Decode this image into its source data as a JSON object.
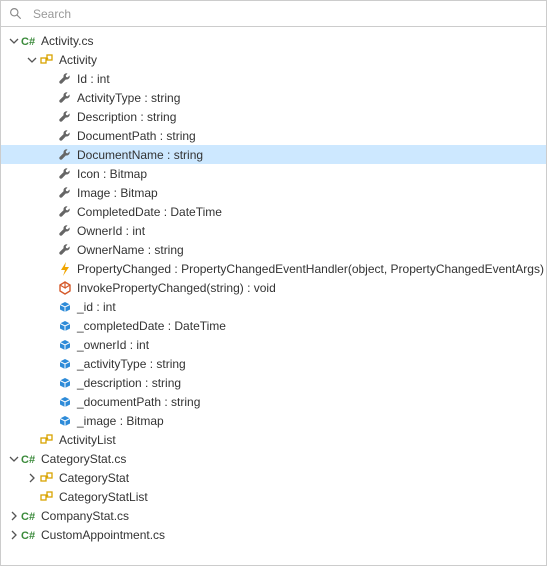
{
  "search": {
    "placeholder": "Search",
    "value": ""
  },
  "tree": [
    {
      "depth": 0,
      "expander": "open",
      "icon": "cs-file",
      "label": "Activity.cs",
      "selected": false
    },
    {
      "depth": 1,
      "expander": "open",
      "icon": "class",
      "label": "Activity",
      "selected": false
    },
    {
      "depth": 2,
      "expander": "none",
      "icon": "wrench",
      "label": "Id : int",
      "selected": false
    },
    {
      "depth": 2,
      "expander": "none",
      "icon": "wrench",
      "label": "ActivityType : string",
      "selected": false
    },
    {
      "depth": 2,
      "expander": "none",
      "icon": "wrench",
      "label": "Description : string",
      "selected": false
    },
    {
      "depth": 2,
      "expander": "none",
      "icon": "wrench",
      "label": "DocumentPath : string",
      "selected": false
    },
    {
      "depth": 2,
      "expander": "none",
      "icon": "wrench",
      "label": "DocumentName : string",
      "selected": true
    },
    {
      "depth": 2,
      "expander": "none",
      "icon": "wrench",
      "label": "Icon : Bitmap",
      "selected": false
    },
    {
      "depth": 2,
      "expander": "none",
      "icon": "wrench",
      "label": "Image : Bitmap",
      "selected": false
    },
    {
      "depth": 2,
      "expander": "none",
      "icon": "wrench",
      "label": "CompletedDate : DateTime",
      "selected": false
    },
    {
      "depth": 2,
      "expander": "none",
      "icon": "wrench",
      "label": "OwnerId : int",
      "selected": false
    },
    {
      "depth": 2,
      "expander": "none",
      "icon": "wrench",
      "label": "OwnerName : string",
      "selected": false
    },
    {
      "depth": 2,
      "expander": "none",
      "icon": "event",
      "label": "PropertyChanged : PropertyChangedEventHandler(object, PropertyChangedEventArgs)",
      "selected": false
    },
    {
      "depth": 2,
      "expander": "none",
      "icon": "method",
      "label": "InvokePropertyChanged(string) : void",
      "selected": false
    },
    {
      "depth": 2,
      "expander": "none",
      "icon": "field",
      "label": "_id : int",
      "selected": false
    },
    {
      "depth": 2,
      "expander": "none",
      "icon": "field",
      "label": "_completedDate : DateTime",
      "selected": false
    },
    {
      "depth": 2,
      "expander": "none",
      "icon": "field",
      "label": "_ownerId : int",
      "selected": false
    },
    {
      "depth": 2,
      "expander": "none",
      "icon": "field",
      "label": "_activityType : string",
      "selected": false
    },
    {
      "depth": 2,
      "expander": "none",
      "icon": "field",
      "label": "_description : string",
      "selected": false
    },
    {
      "depth": 2,
      "expander": "none",
      "icon": "field",
      "label": "_documentPath : string",
      "selected": false
    },
    {
      "depth": 2,
      "expander": "none",
      "icon": "field",
      "label": "_image : Bitmap",
      "selected": false
    },
    {
      "depth": 1,
      "expander": "none",
      "icon": "class",
      "label": "ActivityList",
      "selected": false
    },
    {
      "depth": 0,
      "expander": "open",
      "icon": "cs-file",
      "label": "CategoryStat.cs",
      "selected": false
    },
    {
      "depth": 1,
      "expander": "closed",
      "icon": "class",
      "label": "CategoryStat",
      "selected": false
    },
    {
      "depth": 1,
      "expander": "none",
      "icon": "class",
      "label": "CategoryStatList",
      "selected": false
    },
    {
      "depth": 0,
      "expander": "closed",
      "icon": "cs-file",
      "label": "CompanyStat.cs",
      "selected": false
    },
    {
      "depth": 0,
      "expander": "closed",
      "icon": "cs-file",
      "label": "CustomAppointment.cs",
      "selected": false
    }
  ]
}
